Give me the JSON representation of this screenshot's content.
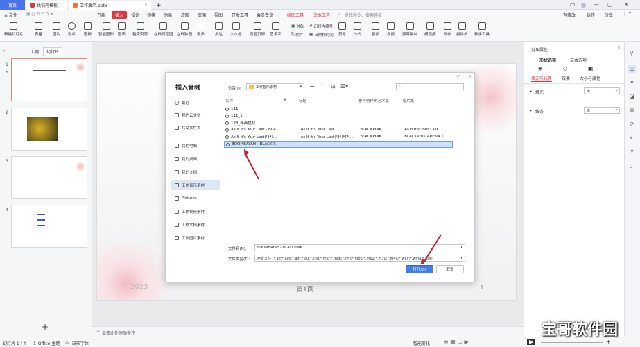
{
  "titlebar": {
    "tab_home": "首页",
    "tab_template": "找稻壳模板",
    "tab_doc": "工作演示.pptx",
    "plus": "+"
  },
  "menubar": {
    "file": "≡ 文件",
    "items": [
      "开始",
      "插入",
      "设计",
      "切换",
      "动画",
      "放映",
      "审阅",
      "视图",
      "开发工具",
      "会员专享"
    ],
    "active_index": 1,
    "extra": [
      "绘图工具",
      "文本工具"
    ],
    "search_placeholder": "查找命令、搜索模板",
    "right": [
      "有修改",
      "协作",
      "分享"
    ]
  },
  "ribbon": {
    "items": [
      "新建幻灯片",
      "表格",
      "图片",
      "形状",
      "图标",
      "智能图形",
      "图表",
      "稻壳资源",
      "在线流程图",
      "在线脑图",
      "更多",
      "批注",
      "文本框",
      "页眉页脚",
      "艺术字",
      "对象",
      "附件",
      "幻灯片编号",
      "日期和时间",
      "符号",
      "公式",
      "音频",
      "视频",
      "屏幕录制",
      "超链接",
      "动作",
      "摄像头",
      "教学工具"
    ]
  },
  "leftpanel": {
    "tab_outline": "大纲",
    "tab_slides": "幻灯片",
    "slide_numbers": [
      "1",
      "2",
      "3",
      "4"
    ],
    "add": "+"
  },
  "slide": {
    "year_text": "2023",
    "page_text": "第1页",
    "page_num": "1"
  },
  "rightpanel": {
    "title": "对象属性",
    "tabs": [
      "形状选项",
      "文本选项"
    ],
    "subtabs": [
      "填充与线条",
      "效果",
      "大小与属性"
    ],
    "fill_label": "填充",
    "fill_value": "无",
    "line_label": "线条",
    "line_value": "无"
  },
  "dialog": {
    "title": "插入音频",
    "location_label": "位置(I):",
    "location_value": "工作音乐素材",
    "sidebar": [
      "最近",
      "我的云文档",
      "共享文件夹",
      "我的电脑",
      "我的桌面",
      "我的文档",
      "工作音乐素材",
      "Pictures",
      "工作视频素材",
      "工作文档素材",
      "工作图片素材"
    ],
    "sidebar_active": 6,
    "columns": [
      "名称",
      "#",
      "标题",
      "参与创作的艺术家",
      "唱片集"
    ],
    "files": [
      {
        "name": "111",
        "title": "",
        "artist": "",
        "album": ""
      },
      {
        "name": "111_1",
        "title": "",
        "artist": "",
        "album": ""
      },
      {
        "name": "123_伴奏提取",
        "title": "",
        "artist": "",
        "album": ""
      },
      {
        "name": "As If It's Your Last - BLA...",
        "title": "As If It's Your Last",
        "artist": "BLACKPINK",
        "album": "As If It's Your Last"
      },
      {
        "name": "As If It's Your Last(마지...",
        "title": "As If It's Your Last(마지막처...",
        "artist": "BLACKPINK",
        "album": "BLACKPINK ARENA T..."
      },
      {
        "name": "BOOMBAYAH - BLACKP...",
        "title": "",
        "artist": "",
        "album": ""
      }
    ],
    "selected_file": 5,
    "filename_label": "文件名(N):",
    "filename_value": "BOOMBAYAH - BLACKPINK",
    "filetype_label": "文件类型(T):",
    "filetype_value": "声音文件 (*.aif;*.aifc;*.aiff;*.au;*.snd;*.mid;*.midi;*.rmi;*.mp3;*.mp2;*.m3u;*.m4a;*.wav;*.wma;*.asx)",
    "open": "打开(O)",
    "cancel": "取消"
  },
  "statusbar": {
    "slide_info": "幻灯片 1 / 4",
    "theme": "1_Office 主题",
    "font_missing": "缺失字体",
    "notes": "单击此处添加备注",
    "smart": "智能美化",
    "zoom_text": "+"
  },
  "colors": {
    "accent_red": "#e2363f",
    "accent_blue": "#4a74e8",
    "open_button": "#3f7ee6"
  }
}
